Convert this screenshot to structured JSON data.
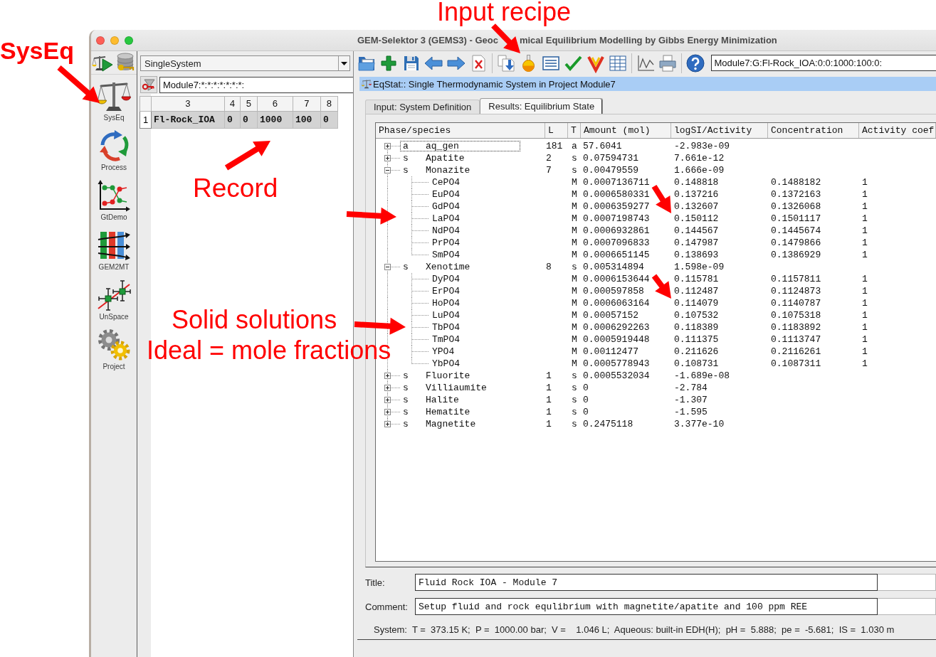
{
  "annotations": [
    {
      "text": "Input recipe",
      "bold": false
    },
    {
      "text": "SysEq",
      "bold": true
    },
    {
      "text": "Record",
      "bold": false
    },
    {
      "text": "Solid solutions",
      "bold": false
    },
    {
      "text": "Ideal = mole fractions",
      "bold": false
    }
  ],
  "window": {
    "title": [
      "GEM-Selektor 3 (GEMS3) - Geoc",
      "mical Equilibrium Modelling by Gibbs Energy Minimization"
    ]
  },
  "modules": [
    {
      "label": "SysEq",
      "kind": "scales"
    },
    {
      "label": "Process",
      "kind": "cycle"
    },
    {
      "label": "GtDemo",
      "kind": "chart"
    },
    {
      "label": "GEM2MT",
      "kind": "bars"
    },
    {
      "label": "UnSpace",
      "kind": "crosshair"
    },
    {
      "label": "Project",
      "kind": "gears"
    }
  ],
  "record_panel": {
    "mode": "SingleSystem",
    "filter": "Module7:*:*:*:*:*:*:*:",
    "table": {
      "columns": [
        "3",
        "4",
        "5",
        "6",
        "7",
        "8"
      ],
      "rows": [
        {
          "number": "1",
          "cells": [
            "Fl-Rock_IOA",
            "0",
            "0",
            "1000",
            "100",
            "0"
          ],
          "selected": true
        }
      ]
    }
  },
  "toolbar": {
    "record_key": "Module7:G:Fl-Rock_IOA:0:0:1000:100:0:"
  },
  "panel": {
    "title": "EqStat:: Single Thermodynamic System in Project Module7",
    "tabs": [
      {
        "label": "Input: System Definition",
        "selected": false
      },
      {
        "label": "Results: Equilibrium State",
        "selected": true
      }
    ]
  },
  "results": {
    "columns": [
      "Phase/species",
      "L",
      "T",
      "Amount (mol)",
      "logSI/Activity",
      "Concentration",
      "Activity coef"
    ],
    "phases": [
      {
        "class": "a",
        "name": "aq_gen",
        "l": "181",
        "t": "a",
        "amount": "57.6041",
        "logsi": "-2.983e-09",
        "expanded": false,
        "focused": true
      },
      {
        "class": "s",
        "name": "Apatite",
        "l": "2",
        "t": "s",
        "amount": "0.07594731",
        "logsi": "7.661e-12",
        "expanded": false,
        "focused": false
      },
      {
        "class": "s",
        "name": "Monazite",
        "l": "7",
        "t": "s",
        "amount": "0.00479559",
        "logsi": "1.666e-09",
        "expanded": true,
        "focused": false,
        "children": [
          {
            "name": "CePO4",
            "t": "M",
            "amount": "0.0007136711",
            "logsi": "0.148818",
            "concentration": "0.1488182",
            "activity_coef": "1"
          },
          {
            "name": "EuPO4",
            "t": "M",
            "amount": "0.0006580331",
            "logsi": "0.137216",
            "concentration": "0.1372163",
            "activity_coef": "1"
          },
          {
            "name": "GdPO4",
            "t": "M",
            "amount": "0.0006359277",
            "logsi": "0.132607",
            "concentration": "0.1326068",
            "activity_coef": "1"
          },
          {
            "name": "LaPO4",
            "t": "M",
            "amount": "0.0007198743",
            "logsi": "0.150112",
            "concentration": "0.1501117",
            "activity_coef": "1"
          },
          {
            "name": "NdPO4",
            "t": "M",
            "amount": "0.0006932861",
            "logsi": "0.144567",
            "concentration": "0.1445674",
            "activity_coef": "1"
          },
          {
            "name": "PrPO4",
            "t": "M",
            "amount": "0.0007096833",
            "logsi": "0.147987",
            "concentration": "0.1479866",
            "activity_coef": "1"
          },
          {
            "name": "SmPO4",
            "t": "M",
            "amount": "0.0006651145",
            "logsi": "0.138693",
            "concentration": "0.1386929",
            "activity_coef": "1"
          }
        ]
      },
      {
        "class": "s",
        "name": "Xenotime",
        "l": "8",
        "t": "s",
        "amount": "0.005314894",
        "logsi": "1.598e-09",
        "expanded": true,
        "focused": false,
        "children": [
          {
            "name": "DyPO4",
            "t": "M",
            "amount": "0.0006153644",
            "logsi": "0.115781",
            "concentration": "0.1157811",
            "activity_coef": "1"
          },
          {
            "name": "ErPO4",
            "t": "M",
            "amount": "0.000597858",
            "logsi": "0.112487",
            "concentration": "0.1124873",
            "activity_coef": "1"
          },
          {
            "name": "HoPO4",
            "t": "M",
            "amount": "0.0006063164",
            "logsi": "0.114079",
            "concentration": "0.1140787",
            "activity_coef": "1"
          },
          {
            "name": "LuPO4",
            "t": "M",
            "amount": "0.00057152",
            "logsi": "0.107532",
            "concentration": "0.1075318",
            "activity_coef": "1"
          },
          {
            "name": "TbPO4",
            "t": "M",
            "amount": "0.0006292263",
            "logsi": "0.118389",
            "concentration": "0.1183892",
            "activity_coef": "1"
          },
          {
            "name": "TmPO4",
            "t": "M",
            "amount": "0.0005919448",
            "logsi": "0.111375",
            "concentration": "0.1113747",
            "activity_coef": "1"
          },
          {
            "name": "YPO4",
            "t": "M",
            "amount": "0.00112477",
            "logsi": "0.211626",
            "concentration": "0.2116261",
            "activity_coef": "1"
          },
          {
            "name": "YbPO4",
            "t": "M",
            "amount": "0.0005778943",
            "logsi": "0.108731",
            "concentration": "0.1087311",
            "activity_coef": "1"
          }
        ]
      },
      {
        "class": "s",
        "name": "Fluorite",
        "l": "1",
        "t": "s",
        "amount": "0.0005532034",
        "logsi": "-1.689e-08",
        "expanded": false,
        "focused": false
      },
      {
        "class": "s",
        "name": "Villiaumite",
        "l": "1",
        "t": "s",
        "amount": "0",
        "logsi": "-2.784",
        "expanded": false,
        "focused": false
      },
      {
        "class": "s",
        "name": "Halite",
        "l": "1",
        "t": "s",
        "amount": "0",
        "logsi": "-1.307",
        "expanded": false,
        "focused": false
      },
      {
        "class": "s",
        "name": "Hematite",
        "l": "1",
        "t": "s",
        "amount": "0",
        "logsi": "-1.595",
        "expanded": false,
        "focused": false
      },
      {
        "class": "s",
        "name": "Magnetite",
        "l": "1",
        "t": "s",
        "amount": "0.2475118",
        "logsi": "3.377e-10",
        "expanded": false,
        "focused": false
      }
    ]
  },
  "form": {
    "title_label": "Title:",
    "title": "Fluid Rock IOA - Module 7",
    "comment_label": "Comment:",
    "comment": "Setup fluid and rock equlibrium with magnetite/apatite and 100 ppm REE"
  },
  "status_bar": "System:  T =  373.15 K;  P =  1000.00 bar;  V =    1.046 L;  Aqueous: built-in EDH(H);  pH =  5.888;  pe =  -5.681;  IS =  1.030 m"
}
